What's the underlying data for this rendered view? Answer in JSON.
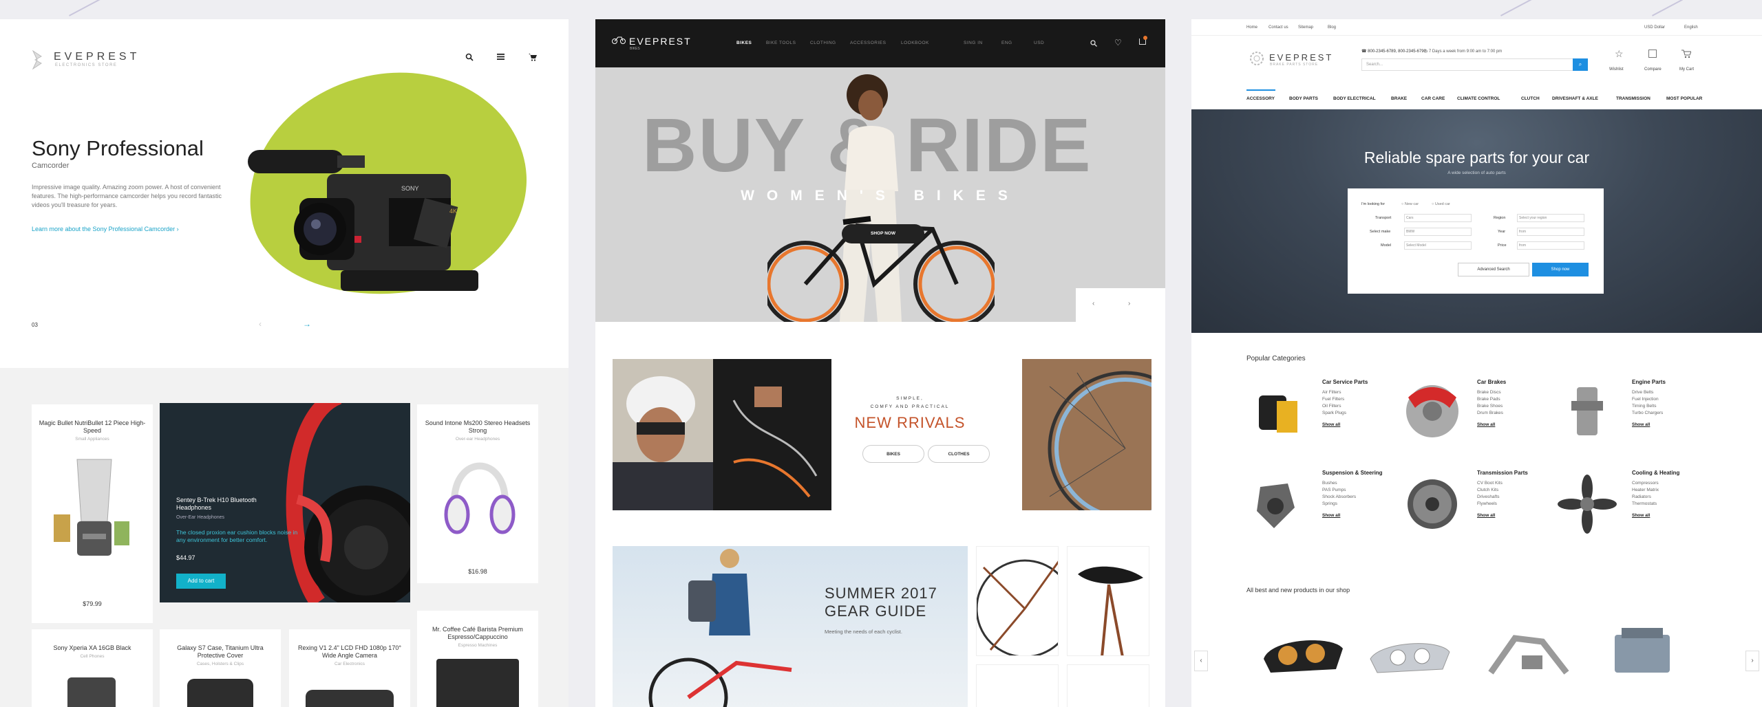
{
  "panel1": {
    "logo": {
      "name": "EVEPREST",
      "sub": "ELECTRONICS STORE"
    },
    "hero": {
      "title": "Sony Professional",
      "subtitle": "Camcorder",
      "desc": "Impressive image quality. Amazing zoom power. A host of convenient features. The high-performance camcorder helps you record fantastic videos you'll treasure for years.",
      "link": "Learn more about the Sony Professional Camcorder",
      "slide": "03"
    },
    "products": [
      {
        "title": "Magic Bullet NutriBullet 12 Piece High-Speed",
        "cat": "Small Appliances",
        "price": "$79.99"
      },
      {
        "title": "Sound Intone Ms200 Stereo Headsets Strong",
        "cat": "Over-ear Headphones",
        "price": "$16.98"
      },
      {
        "title": "Sony Xperia XA 16GB Black",
        "cat": "Cell Phones"
      },
      {
        "title": "Galaxy S7 Case, Titanium Ultra Protective Cover",
        "cat": "Cases, Holsters & Clips"
      },
      {
        "title": "Rexing V1 2.4\" LCD FHD 1080p 170° Wide Angle Camera",
        "cat": "Car Electronics"
      },
      {
        "title": "Mr. Coffee Café Barista Premium Espresso/Cappuccino",
        "cat": "Espresso Machines"
      }
    ],
    "featured": {
      "title": "Sentey B-Trek H10 Bluetooth Headphones",
      "cat": "Over-Ear Headphones",
      "desc": "The closed proxion ear cushion blocks noise in any environment for better comfort.",
      "price": "$44.97",
      "cta": "Add to cart"
    }
  },
  "panel2": {
    "logo": {
      "name": "EVEPREST",
      "sub": "BIKES"
    },
    "nav": [
      "BIKES",
      "BIKE TOOLS",
      "CLOTHING",
      "ACCESSORIES",
      "LOOKBOOK"
    ],
    "right": [
      "SING IN",
      "ENG",
      "USD"
    ],
    "hero": {
      "big": "BUY & RIDE",
      "sub": "WOMEN'S BIKES",
      "cta": "SHOP NOW"
    },
    "arrivals": {
      "pre1": "SIMPLE,",
      "pre2": "COMFY AND PRACTICAL",
      "title": "NEW RRIVALS",
      "b1": "BIKES",
      "b2": "CLOTHES"
    },
    "guide": {
      "t1": "SUMMER 2017",
      "t2": "GEAR GUIDE",
      "sub": "Meeting the needs of each cyclist."
    }
  },
  "panel3": {
    "top": [
      "Home",
      "Contact us",
      "Sitemap",
      "Blog"
    ],
    "topright": [
      "USD Dollar",
      "English"
    ],
    "logo": {
      "name": "EVEPREST",
      "sub": "BRAKE PARTS STORE"
    },
    "phone": "800-2345-6789, 800-2345-6790",
    "hours": "7 Days a week from 9:00 am to 7:00 pm",
    "search": "Search...",
    "actions": [
      "Wishlist",
      "Compare",
      "My Cart"
    ],
    "cats": [
      "ACCESSORY",
      "BODY PARTS",
      "BODY ELECTRICAL",
      "BRAKE",
      "CAR CARE",
      "CLIMATE CONTROL",
      "CLUTCH",
      "DRIVESHAFT & AXLE",
      "TRANSMISSION",
      "MOST POPULAR"
    ],
    "hero": {
      "title": "Reliable spare parts for your car",
      "sub": "A wide selection of auto parts"
    },
    "form": {
      "looking": "I'm looking for",
      "r1": "New car",
      "r2": "Used car",
      "labels": [
        "Transport",
        "Select make",
        "Model",
        "Region",
        "Year",
        "Price"
      ],
      "values": [
        "Cars",
        "BMW",
        "Select Model",
        "Select your region",
        "from",
        "from"
      ],
      "adv": "Advanced Search",
      "shop": "Shop now"
    },
    "popular": "Popular Categories",
    "categories": [
      {
        "name": "Car Service Parts",
        "items": [
          "Air Filters",
          "Fuel Filters",
          "Oil Filters",
          "Spark Plugs"
        ]
      },
      {
        "name": "Car Brakes",
        "items": [
          "Brake Discs",
          "Brake Pads",
          "Brake Shoes",
          "Drum Brakes"
        ]
      },
      {
        "name": "Engine Parts",
        "items": [
          "Drive Belts",
          "Fuel Injection",
          "Timing Belts",
          "Turbo Chargers"
        ]
      },
      {
        "name": "Suspension & Steering",
        "items": [
          "Bushes",
          "PAS Pumps",
          "Shock Absorbers",
          "Springs"
        ]
      },
      {
        "name": "Transmission Parts",
        "items": [
          "CV Boot Kits",
          "Clutch Kits",
          "Driveshafts",
          "Flywheels"
        ]
      },
      {
        "name": "Cooling & Heating",
        "items": [
          "Compressors",
          "Heater Matrix",
          "Radiators",
          "Thermostats"
        ]
      }
    ],
    "showall": "Show all",
    "best": "All best and new products in our shop"
  }
}
